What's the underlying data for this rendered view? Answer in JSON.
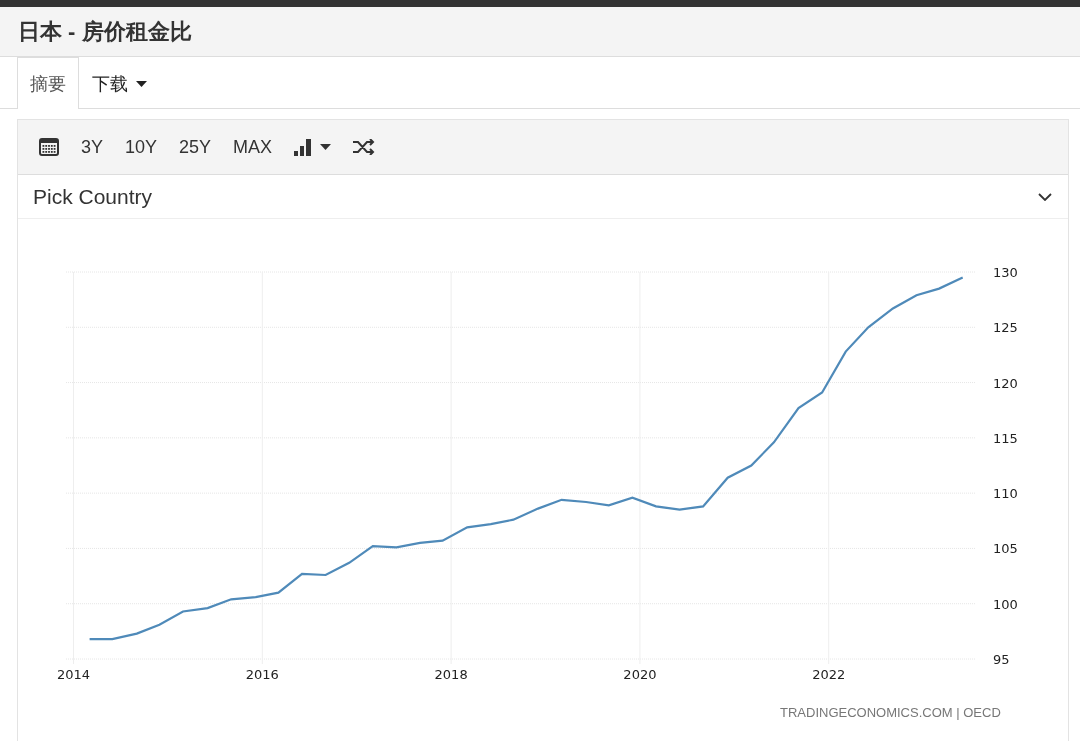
{
  "title": "日本 - 房价租金比",
  "tabs": [
    {
      "label": "摘要",
      "selected": true,
      "kind": "tab"
    },
    {
      "label": "下载",
      "selected": false,
      "kind": "dropdown"
    }
  ],
  "toolbar": {
    "ranges": [
      "3Y",
      "10Y",
      "25Y",
      "MAX"
    ]
  },
  "country_picker": {
    "label": "Pick Country",
    "expanded": false
  },
  "chart": {
    "source": "TRADINGECONOMICS.COM | OECD",
    "chart_data": {
      "type": "line",
      "grid": true,
      "xlim": [
        2013.92,
        2023.55
      ],
      "ylim": [
        95,
        130
      ],
      "xticks": [
        2014,
        2016,
        2018,
        2020,
        2022
      ],
      "yticks": [
        95,
        100,
        105,
        110,
        115,
        120,
        125,
        130
      ],
      "x": [
        2014.17,
        2014.41,
        2014.67,
        2014.91,
        2015.16,
        2015.42,
        2015.67,
        2015.93,
        2016.17,
        2016.42,
        2016.67,
        2016.92,
        2017.17,
        2017.42,
        2017.67,
        2017.91,
        2018.17,
        2018.42,
        2018.66,
        2018.92,
        2019.17,
        2019.43,
        2019.67,
        2019.92,
        2020.17,
        2020.42,
        2020.67,
        2020.93,
        2021.18,
        2021.42,
        2021.68,
        2021.93,
        2022.18,
        2022.42,
        2022.68,
        2022.93,
        2023.17,
        2023.42
      ],
      "series": [
        {
          "color": "#4f8ab9",
          "values": [
            96.8,
            96.8,
            97.3,
            98.1,
            99.3,
            99.6,
            100.4,
            100.6,
            101.0,
            102.7,
            102.6,
            103.7,
            105.2,
            105.1,
            105.5,
            105.7,
            106.9,
            107.2,
            107.6,
            108.6,
            109.4,
            109.2,
            108.9,
            109.6,
            108.8,
            108.5,
            108.8,
            111.4,
            112.5,
            114.6,
            117.7,
            119.1,
            122.8,
            125.0,
            126.7,
            127.9,
            128.5,
            129.5
          ]
        }
      ]
    }
  }
}
